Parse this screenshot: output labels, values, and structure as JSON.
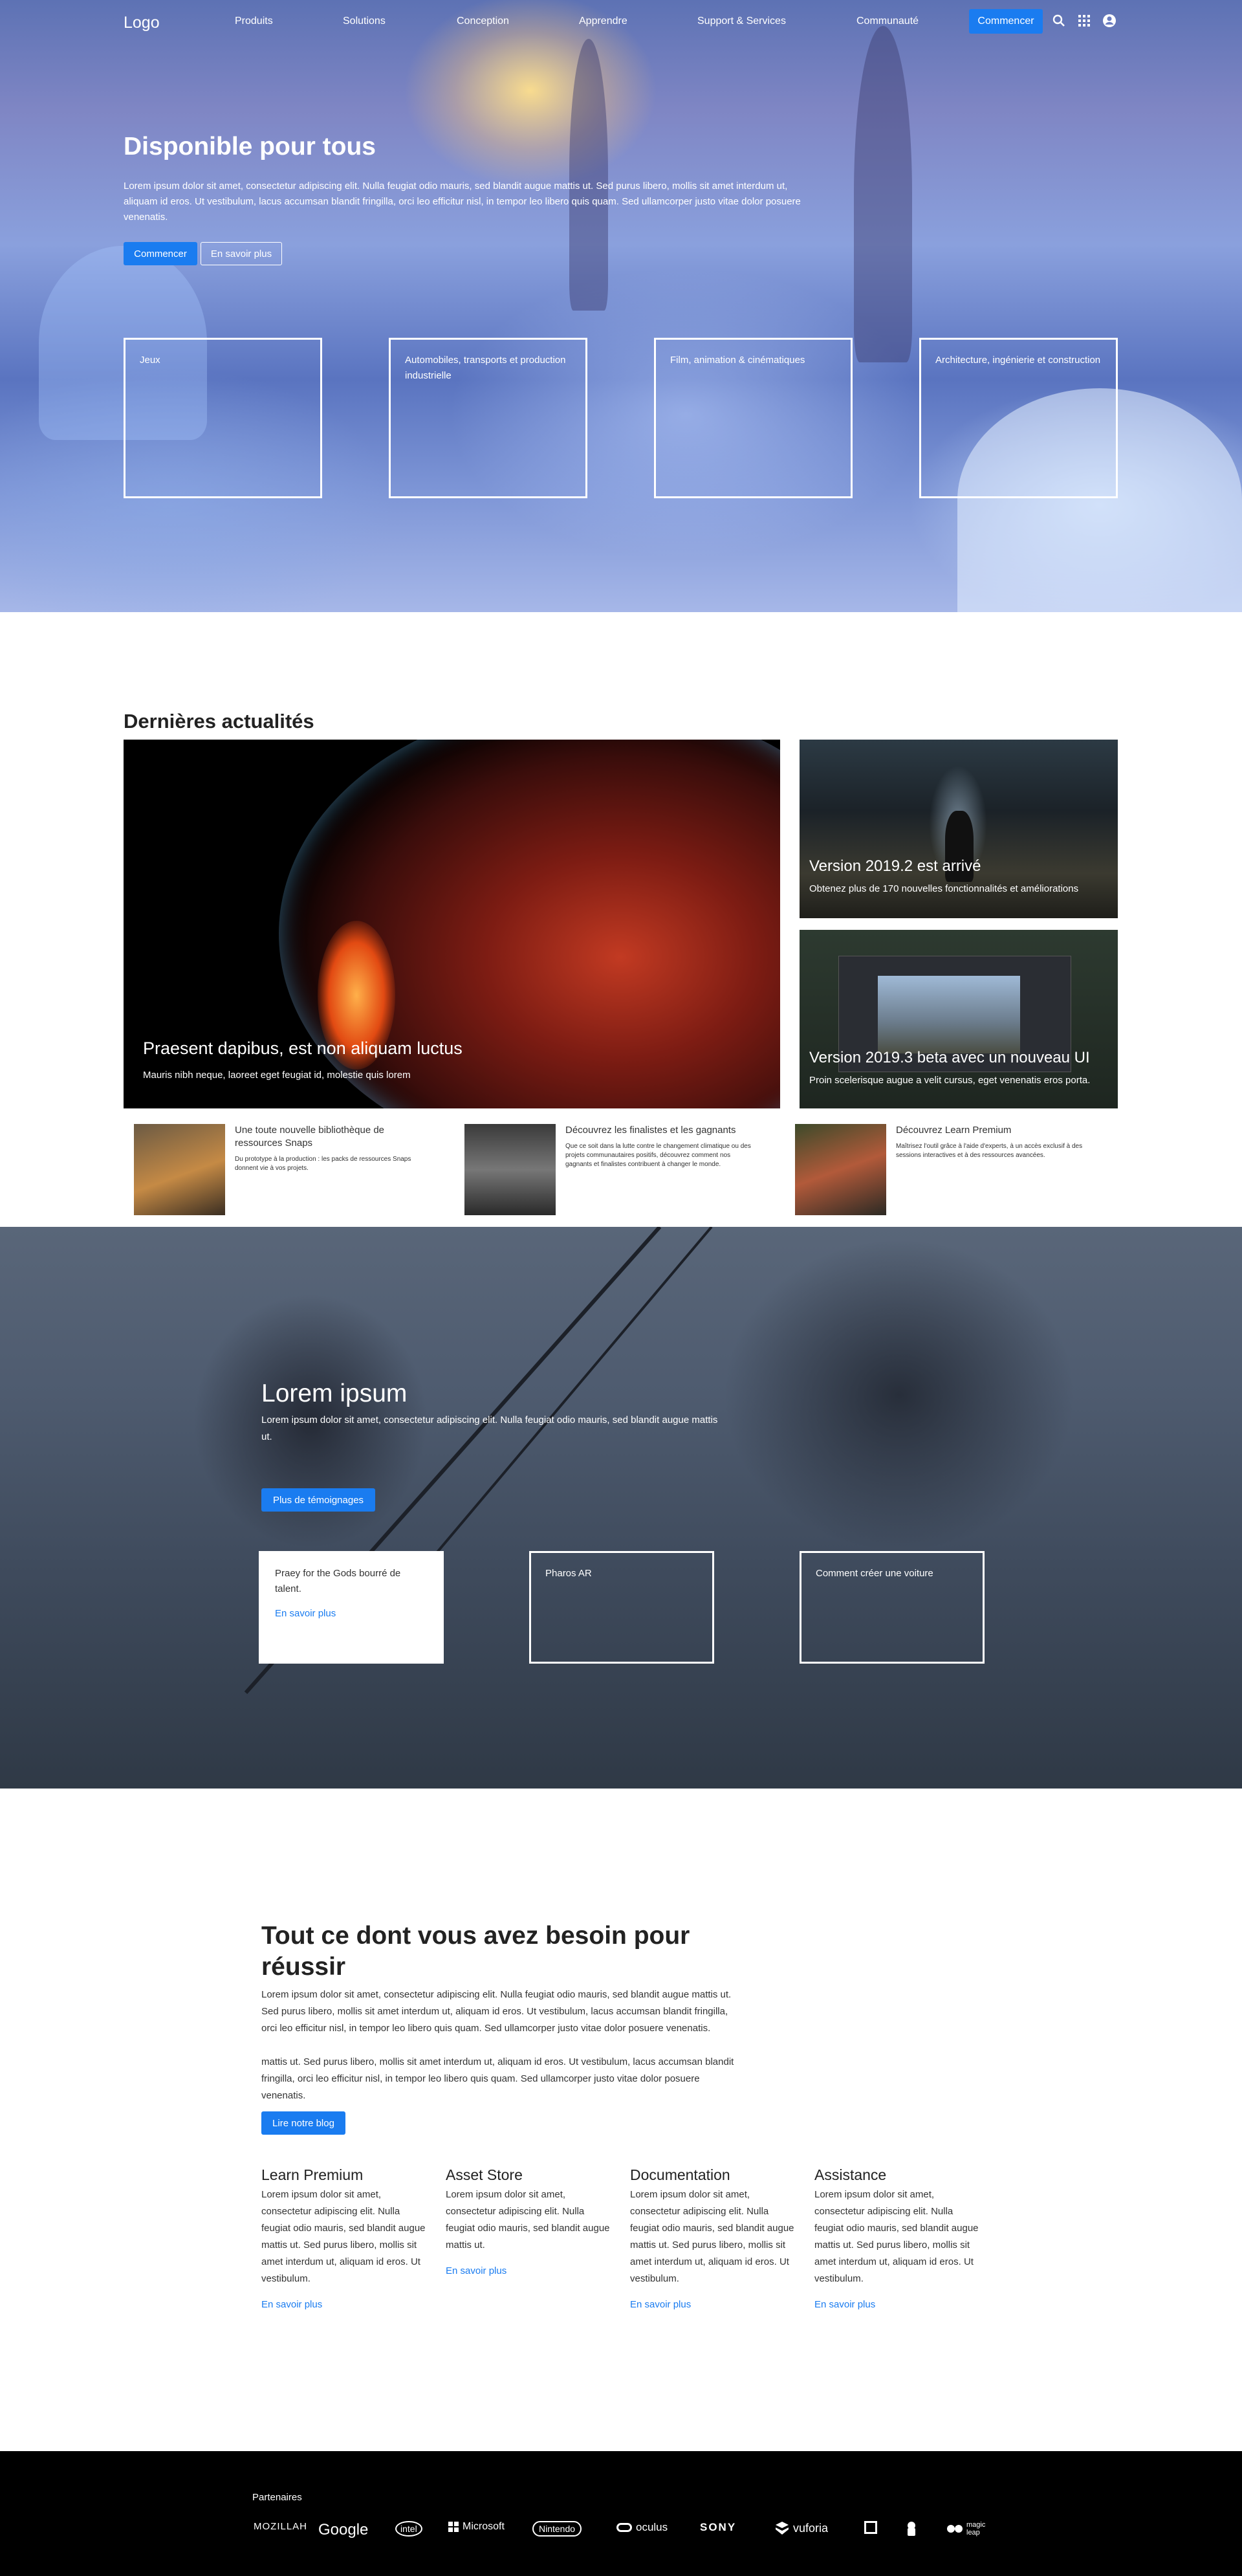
{
  "nav": {
    "logo": "Logo",
    "items": [
      "Produits",
      "Solutions",
      "Conception",
      "Apprendre",
      "Support & Services",
      "Communauté"
    ],
    "cta": "Commencer"
  },
  "hero": {
    "title": "Disponible pour tous",
    "text": "Lorem ipsum dolor sit amet, consectetur adipiscing elit. Nulla feugiat odio mauris, sed blandit augue mattis ut. Sed purus libero, mollis sit amet interdum ut, aliquam id eros. Ut vestibulum, lacus accumsan blandit fringilla, orci leo efficitur nisl, in tempor leo libero quis quam. Sed ullamcorper justo vitae dolor posuere venenatis.",
    "btn_primary": "Commencer",
    "btn_secondary": "En savoir plus",
    "cards": [
      "Jeux",
      "Automobiles, transports et production industrielle",
      "Film, animation & cinématiques",
      "Architecture, ingénierie et construction"
    ]
  },
  "news": {
    "title": "Dernières actualités",
    "feature": {
      "title": "Praesent dapibus, est non aliquam luctus",
      "subtitle": "Mauris nibh neque, laoreet eget feugiat id, molestie quis lorem"
    },
    "side": [
      {
        "title": "Version 2019.2 est arrivé",
        "subtitle": "Obtenez plus de 170 nouvelles fonctionnalités et améliorations"
      },
      {
        "title": "Version 2019.3 beta avec un nouveau UI",
        "subtitle": "Proin scelerisque augue a velit cursus, eget venenatis eros porta."
      }
    ],
    "minis": [
      {
        "title": "Une toute nouvelle bibliothèque de ressources Snaps",
        "text": "Du prototype à la production : les packs de ressources Snaps donnent vie à vos projets."
      },
      {
        "title": "Découvrez les finalistes et les gagnants",
        "text": "Que ce soit dans la lutte contre le changement climatique ou des projets communautaires positifs, découvrez comment nos gagnants et finalistes contribuent à changer le monde."
      },
      {
        "title": "Découvrez Learn Premium",
        "text": "Maîtrisez l'outil grâce à l'aide d'experts, à un accès exclusif à des sessions interactives et à des ressources avancées."
      }
    ]
  },
  "testimonials": {
    "title": "Lorem ipsum",
    "text": "Lorem ipsum dolor sit amet, consectetur adipiscing elit. Nulla feugiat odio mauris, sed blandit augue mattis ut.",
    "button": "Plus de témoignages",
    "cards": [
      {
        "title": "Praey for the Gods bourré de talent.",
        "link": "En savoir plus"
      },
      {
        "title": "Pharos AR",
        "link": ""
      },
      {
        "title": "Comment créer une voiture",
        "link": ""
      }
    ]
  },
  "needs": {
    "title": "Tout ce dont vous avez besoin pour réussir",
    "text1": "Lorem ipsum dolor sit amet, consectetur adipiscing elit. Nulla feugiat odio mauris, sed blandit augue mattis ut. Sed purus libero, mollis sit amet interdum ut, aliquam id eros. Ut vestibulum, lacus accumsan blandit fringilla, orci leo efficitur nisl, in tempor leo libero quis quam. Sed ullamcorper justo vitae dolor posuere venenatis.",
    "text2": "mattis ut. Sed purus libero, mollis sit amet interdum ut, aliquam id eros. Ut vestibulum, lacus accumsan blandit fringilla, orci leo efficitur nisl, in tempor leo libero quis quam. Sed ullamcorper justo vitae dolor posuere venenatis.",
    "button": "Lire notre blog",
    "columns": [
      {
        "title": "Learn Premium",
        "text": "Lorem ipsum dolor sit amet, consectetur adipiscing elit. Nulla feugiat odio mauris, sed blandit augue mattis ut. Sed purus libero, mollis sit amet interdum ut, aliquam id eros. Ut vestibulum.",
        "link": "En savoir plus"
      },
      {
        "title": "Asset Store",
        "text": "Lorem ipsum dolor sit amet, consectetur adipiscing elit. Nulla feugiat odio mauris, sed blandit augue mattis ut.",
        "link": "En savoir plus"
      },
      {
        "title": "Documentation",
        "text": "Lorem ipsum dolor sit amet, consectetur adipiscing elit. Nulla feugiat odio mauris, sed blandit augue mattis ut. Sed purus libero, mollis sit amet interdum ut, aliquam id eros. Ut vestibulum.",
        "link": "En savoir plus"
      },
      {
        "title": "Assistance",
        "text": "Lorem ipsum dolor sit amet, consectetur adipiscing elit. Nulla feugiat odio mauris, sed blandit augue mattis ut. Sed purus libero, mollis sit amet interdum ut, aliquam id eros. Ut vestibulum.",
        "link": "En savoir plus"
      }
    ]
  },
  "footer": {
    "partners_label": "Partenaires",
    "logos": [
      "MOZILLAH",
      "Google",
      "intel",
      "Microsoft",
      "Nintendo",
      "oculus",
      "SONY",
      "vuforia",
      "magic leap"
    ]
  },
  "colors": {
    "accent": "#1a7cf0",
    "footer": "#000000"
  }
}
